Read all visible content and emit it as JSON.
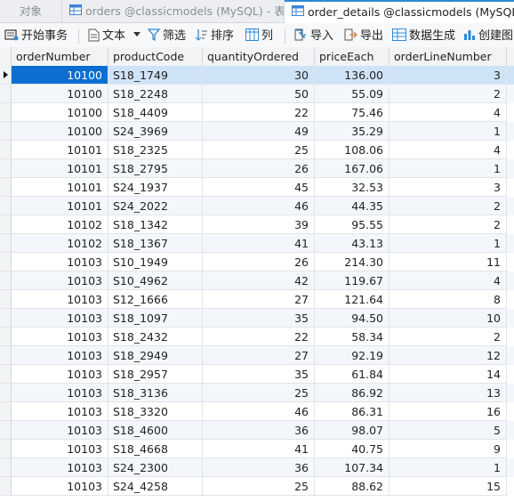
{
  "tabs": [
    {
      "label": "对象"
    },
    {
      "label": "orders @classicmodels (MySQL) - 表"
    },
    {
      "label": "order_details @classicmodels (MySQL..."
    }
  ],
  "toolbar": {
    "begin_transaction": "开始事务",
    "text": "文本",
    "filter": "筛选",
    "sort": "排序",
    "columns": "列",
    "import": "导入",
    "export": "导出",
    "data_generation": "数据生成",
    "create_chart": "创建图"
  },
  "table": {
    "columns": [
      "orderNumber",
      "productCode",
      "quantityOrdered",
      "priceEach",
      "orderLineNumber"
    ],
    "rows": [
      [
        "10100",
        "S18_1749",
        "30",
        "136.00",
        "3"
      ],
      [
        "10100",
        "S18_2248",
        "50",
        "55.09",
        "2"
      ],
      [
        "10100",
        "S18_4409",
        "22",
        "75.46",
        "4"
      ],
      [
        "10100",
        "S24_3969",
        "49",
        "35.29",
        "1"
      ],
      [
        "10101",
        "S18_2325",
        "25",
        "108.06",
        "4"
      ],
      [
        "10101",
        "S18_2795",
        "26",
        "167.06",
        "1"
      ],
      [
        "10101",
        "S24_1937",
        "45",
        "32.53",
        "3"
      ],
      [
        "10101",
        "S24_2022",
        "46",
        "44.35",
        "2"
      ],
      [
        "10102",
        "S18_1342",
        "39",
        "95.55",
        "2"
      ],
      [
        "10102",
        "S18_1367",
        "41",
        "43.13",
        "1"
      ],
      [
        "10103",
        "S10_1949",
        "26",
        "214.30",
        "11"
      ],
      [
        "10103",
        "S10_4962",
        "42",
        "119.67",
        "4"
      ],
      [
        "10103",
        "S12_1666",
        "27",
        "121.64",
        "8"
      ],
      [
        "10103",
        "S18_1097",
        "35",
        "94.50",
        "10"
      ],
      [
        "10103",
        "S18_2432",
        "22",
        "58.34",
        "2"
      ],
      [
        "10103",
        "S18_2949",
        "27",
        "92.19",
        "12"
      ],
      [
        "10103",
        "S18_2957",
        "35",
        "61.84",
        "14"
      ],
      [
        "10103",
        "S18_3136",
        "25",
        "86.92",
        "13"
      ],
      [
        "10103",
        "S18_3320",
        "46",
        "86.31",
        "16"
      ],
      [
        "10103",
        "S18_4600",
        "36",
        "98.07",
        "5"
      ],
      [
        "10103",
        "S18_4668",
        "41",
        "40.75",
        "9"
      ],
      [
        "10103",
        "S24_2300",
        "36",
        "107.34",
        "1"
      ],
      [
        "10103",
        "S24_4258",
        "25",
        "88.62",
        "15"
      ]
    ]
  },
  "colors": {
    "selected_cell": "#0a6fd0",
    "selected_row": "#cfe3f7",
    "accent": "#2e89d8"
  }
}
